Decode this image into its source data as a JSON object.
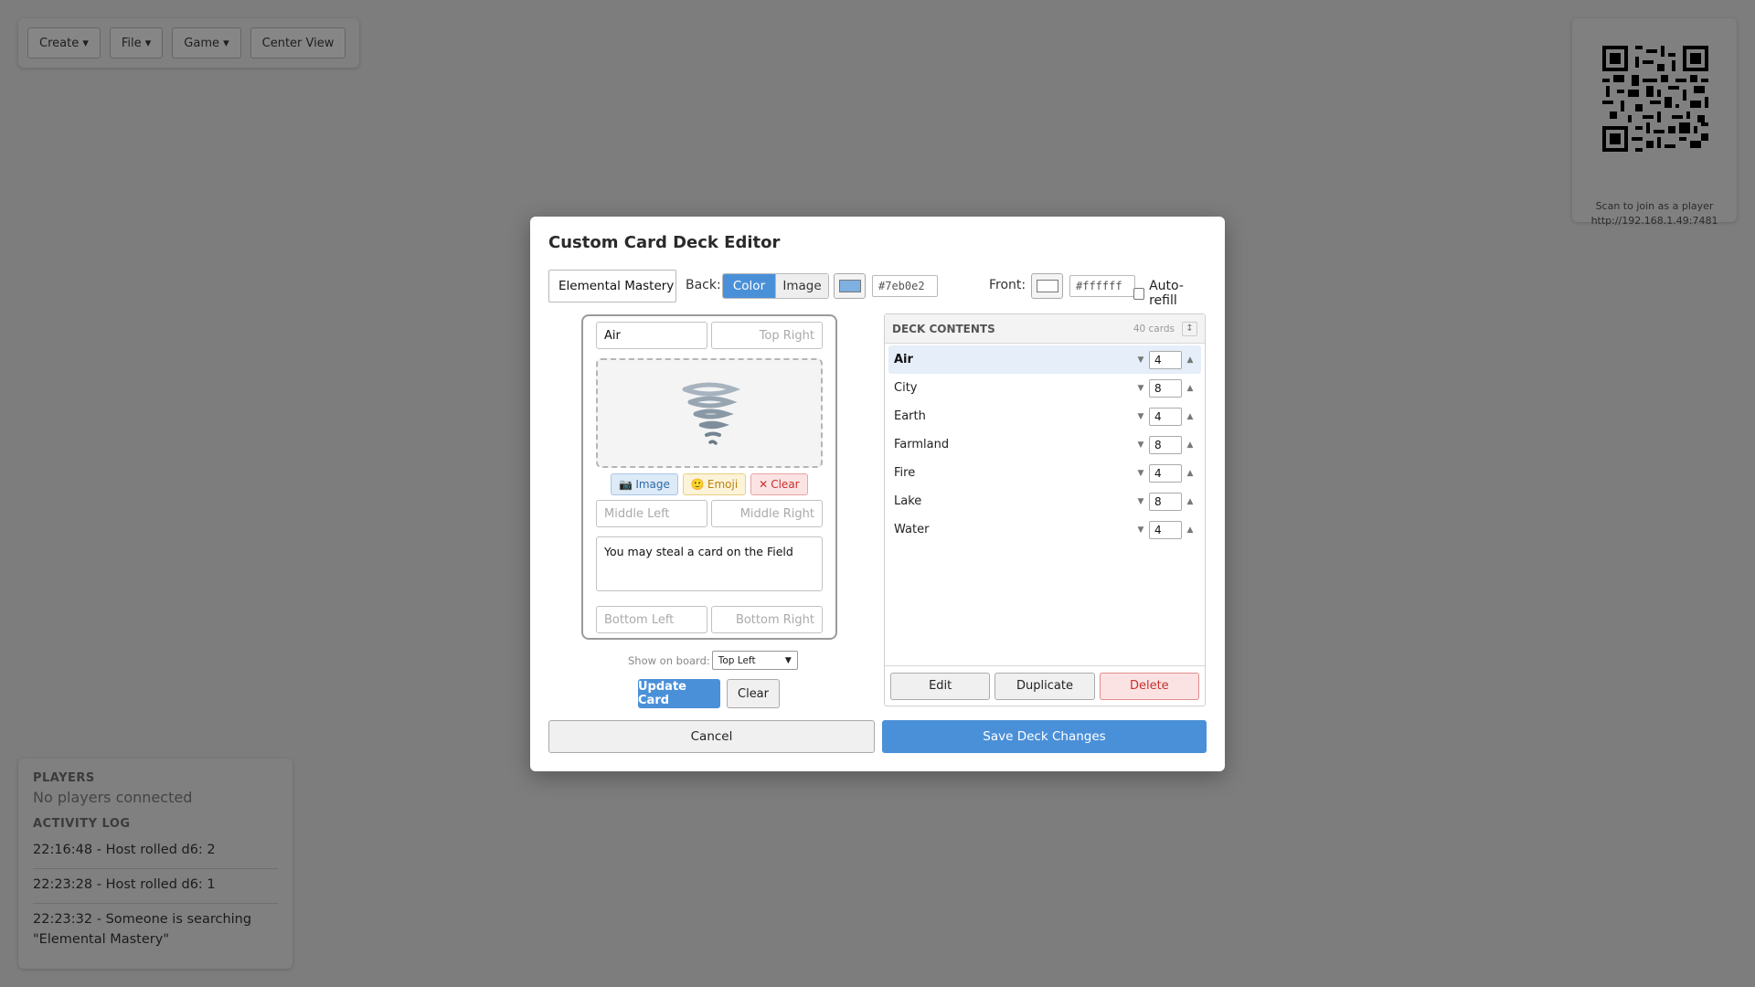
{
  "toolbar": {
    "create": "Create ▾",
    "file": "File ▾",
    "game": "Game ▾",
    "center_view": "Center View"
  },
  "qr": {
    "caption": "Scan to join as a player",
    "url": "http://192.168.1.49:7481"
  },
  "info": {
    "players_heading": "PLAYERS",
    "players_status": "No players connected",
    "activity_heading": "ACTIVITY LOG",
    "log": [
      "22:16:48 - Host rolled d6: 2",
      "22:23:28 - Host rolled d6: 1",
      "22:23:32 - Someone is searching \"Elemental Mastery\""
    ]
  },
  "modal": {
    "title": "Custom Card Deck Editor",
    "deck_name": "Elemental Mastery",
    "back_label": "Back:",
    "back_modes": [
      "Color",
      "Image"
    ],
    "back_color": "#7eb0e2",
    "front_label": "Front:",
    "front_color": "#ffffff",
    "auto_refill": "Auto-refill"
  },
  "card": {
    "top_left": "Air",
    "top_right_placeholder": "Top Right",
    "middle_left_placeholder": "Middle Left",
    "middle_right_placeholder": "Middle Right",
    "bottom_left_placeholder": "Bottom Left",
    "bottom_right_placeholder": "Bottom Right",
    "description": "You may steal a card on the Field",
    "emoji_icon": "tornado-icon",
    "btn_image": "Image",
    "btn_emoji": "Emoji",
    "btn_clear": "Clear",
    "show_on_board_label": "Show on board:",
    "show_on_board_value": "Top Left",
    "update_btn": "Update Card",
    "clear_btn": "Clear"
  },
  "deck": {
    "heading": "DECK CONTENTS",
    "count": "40 cards",
    "sort_icon": "↕",
    "items": [
      {
        "name": "Air",
        "qty": "4"
      },
      {
        "name": "City",
        "qty": "8"
      },
      {
        "name": "Earth",
        "qty": "4"
      },
      {
        "name": "Farmland",
        "qty": "8"
      },
      {
        "name": "Fire",
        "qty": "4"
      },
      {
        "name": "Lake",
        "qty": "8"
      },
      {
        "name": "Water",
        "qty": "4"
      }
    ],
    "edit": "Edit",
    "duplicate": "Duplicate",
    "delete": "Delete"
  },
  "footer": {
    "cancel": "Cancel",
    "save": "Save Deck Changes"
  }
}
